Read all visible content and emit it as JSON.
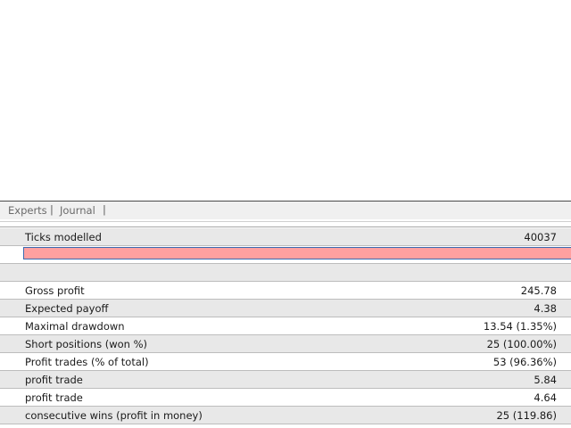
{
  "tabs": [
    {
      "label": "Experts"
    },
    {
      "label": "Journal"
    }
  ],
  "tab_separator": "|",
  "ticks_row": {
    "label": "Ticks modelled",
    "value": "40037"
  },
  "stats": [
    {
      "label": "Gross profit",
      "value": "245.78"
    },
    {
      "label": "Expected payoff",
      "value": "4.38"
    },
    {
      "label": "Maximal drawdown",
      "value": "13.54 (1.35%)"
    },
    {
      "label": "Short positions (won %)",
      "value": "25 (100.00%)"
    },
    {
      "label": "Profit trades (% of total)",
      "value": "53 (96.36%)"
    },
    {
      "label": "profit trade",
      "value": "5.84"
    },
    {
      "label": "profit trade",
      "value": "4.64"
    },
    {
      "label": "consecutive wins (profit in money)",
      "value": "25 (119.86)"
    }
  ],
  "colors": {
    "quality_bar": "#ffa0a0",
    "quality_bar_border": "#3c6ab0",
    "row_shade": "#e8e8e8"
  }
}
